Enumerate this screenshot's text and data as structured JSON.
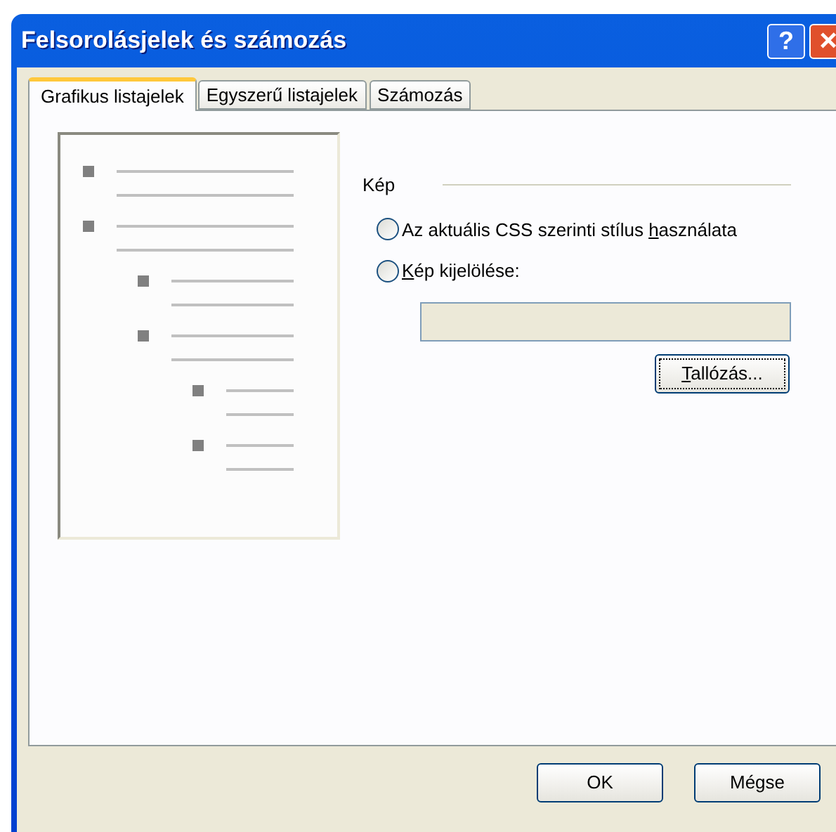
{
  "window": {
    "title": "Felsorolásjelek és számozás",
    "help": "?",
    "close": "×"
  },
  "tabs": [
    {
      "label": "Grafikus listajelek",
      "selected": true
    },
    {
      "label": "Egyszerű listajelek",
      "selected": false
    },
    {
      "label": "Számozás",
      "selected": false
    }
  ],
  "group": {
    "title": "Kép",
    "options": [
      {
        "label": {
          "before": "Az aktuális CSS szerinti stílus ",
          "key": "h",
          "after": "asználata"
        },
        "selected": false
      },
      {
        "label": {
          "key": "K",
          "after": "ép kijelölése:"
        },
        "selected": false
      }
    ],
    "path_field": {
      "disabled": true
    },
    "browse_button": {
      "label": {
        "key": "T",
        "after": "allózás..."
      }
    }
  },
  "buttons": [
    "OK",
    "Mégse"
  ]
}
